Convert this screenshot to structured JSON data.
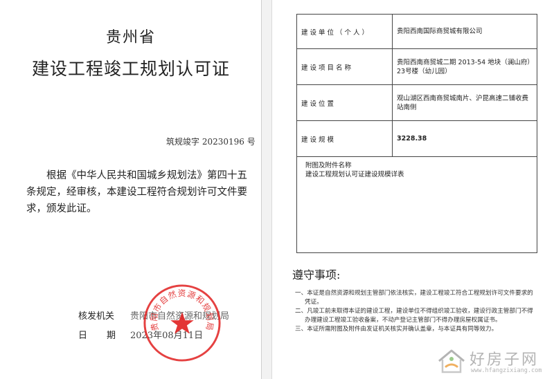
{
  "left": {
    "province": "贵州省",
    "title": "建设工程竣工规划认可证",
    "cert_number": "筑规竣字 20230196 号",
    "body": "根据《中华人民共和国城乡规划法》第四十五条规定，经审核，本建设工程符合规划许可文件要求，颁发此证。",
    "issuer_label": "核发机关",
    "issuer_value": "贵阳市自然资源和规划局",
    "date_label": "日期",
    "date_value": "2023年08月11日",
    "seal_text": "贵阳市自然资源和规划局"
  },
  "table": {
    "rows": [
      {
        "label": "建设单位（个人）",
        "value": "贵阳西南国际商贸城有限公司"
      },
      {
        "label": "建设项目名称",
        "value": "贵阳西南商贸城二期 2013-54 地块（澜山府）23号楼（幼儿园）"
      },
      {
        "label": "建设位置",
        "value": "观山湖区西南商贸城南片、沪昆高速二铺收费站南侧"
      },
      {
        "label": "建设规模",
        "value": "3228.38"
      }
    ],
    "attachments_label": "附图及附件名称",
    "attachments_value": "建设工程规划认可证建设规模详表"
  },
  "rules": {
    "title": "遵守事项:",
    "items": [
      "一、本证是自然资源和规划主管部门依法核实，建设工程竣工符合工程规划许可文件要求的凭证。",
      "二、凡竣工前未取得本证的建设工程，建设单位不得组织竣工验收，建设行政主管部门不得办理建设工程竣工验收备案，不动产登记主管部门不得办理房屋权属证书。",
      "三、本证所需附图及附件由发证机关核实并确认盖章，与本证具有同等效力。"
    ]
  },
  "watermark": {
    "name": "好房子网",
    "url": "www.hfangzixiang.com"
  },
  "colors": {
    "seal_red": "#e02020",
    "watermark_gray": "#b4b4b4"
  }
}
